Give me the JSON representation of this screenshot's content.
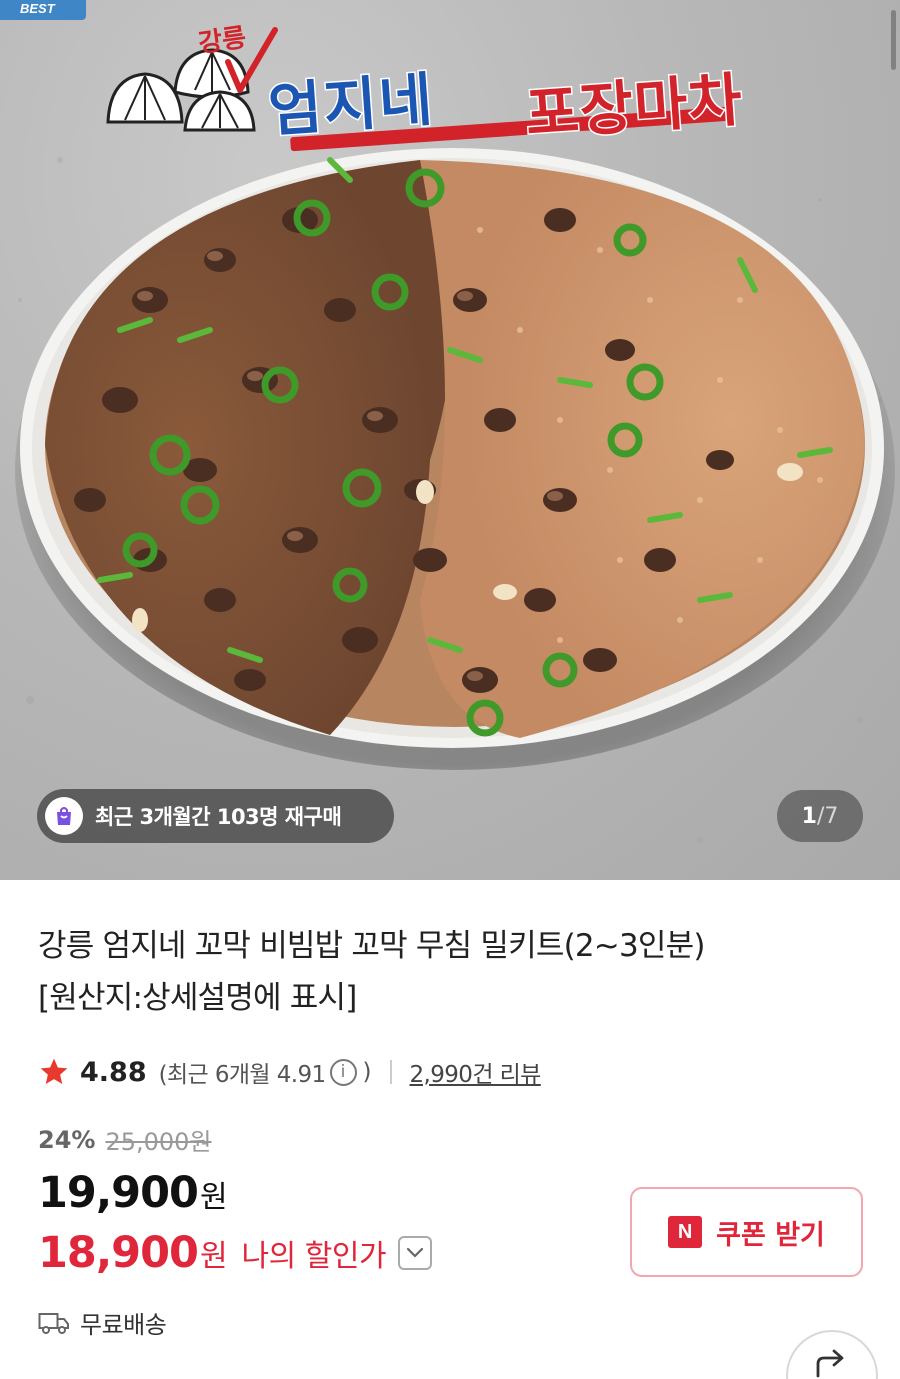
{
  "hero": {
    "best_tag": "BEST",
    "brand": {
      "small_text": "강릉",
      "name_part1": "엄지네",
      "name_part2": "포장마차"
    },
    "repurchase_badge": "최근 3개월간 103명 재구매",
    "page_counter": {
      "current": "1",
      "separator": "/",
      "total": "7"
    }
  },
  "product": {
    "title_line1": "강릉 엄지네 꼬막 비빔밥 꼬막 무침 밀키트(2~3인분)",
    "title_line2": "[원산지:상세설명에 표시]",
    "rating": "4.88",
    "recent_rating_label": "(최근 6개월 4.91",
    "recent_rating_close": ")",
    "review_count": "2,990건 리뷰",
    "discount_percent": "24%",
    "original_price": "25,000원",
    "price": "19,900",
    "price_unit": "원",
    "my_price": "18,900",
    "my_price_unit": "원",
    "my_price_label": "나의 할인가",
    "coupon_badge": "N",
    "coupon_label": "쿠폰 받기",
    "shipping": "무료배송"
  },
  "icons": {
    "star": "star-icon",
    "info": "info-icon",
    "chevron": "chevron-down-icon",
    "truck": "truck-icon",
    "share": "share-icon",
    "bag": "shopping-bag-icon"
  },
  "colors": {
    "accent_red": "#e0263a",
    "star_red": "#e8392f",
    "brand_blue": "#1b56b3",
    "best_blue": "#3f86c6"
  }
}
